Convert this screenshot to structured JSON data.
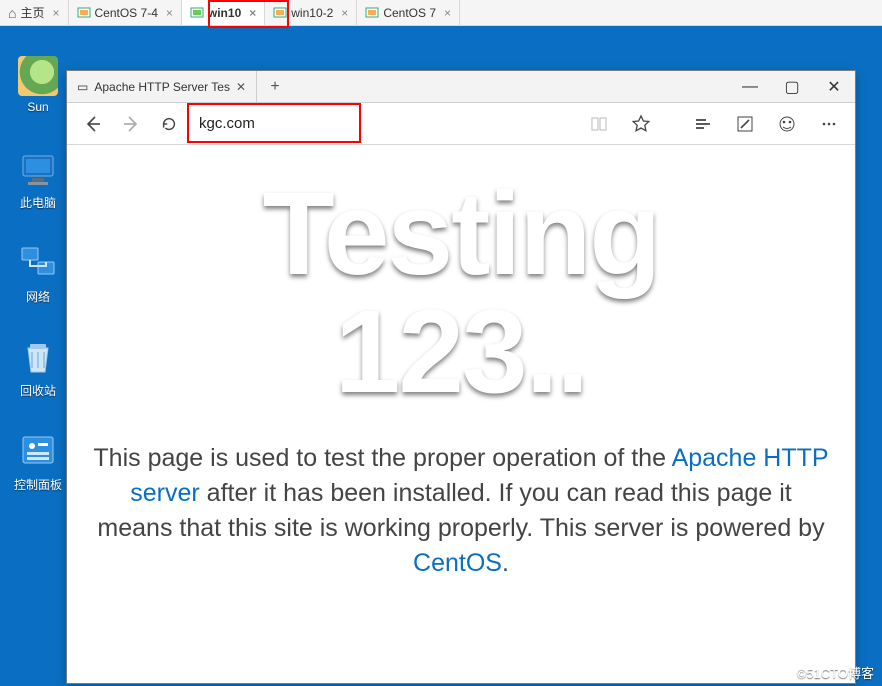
{
  "vm_tabs": [
    {
      "label": "主页",
      "type": "home"
    },
    {
      "label": "CentOS 7-4",
      "type": "vm"
    },
    {
      "label": "win10",
      "type": "vm",
      "active": true
    },
    {
      "label": "win10-2",
      "type": "vm"
    },
    {
      "label": "CentOS 7",
      "type": "vm"
    }
  ],
  "desktop_icons": {
    "sun": "Sun",
    "pc": "此电脑",
    "net": "网络",
    "bin": "回收站",
    "cpl": "控制面板"
  },
  "browser": {
    "tab_title": "Apache HTTP Server Tes",
    "url": "kgc.com",
    "controls": {
      "min": "—",
      "max": "▢",
      "close": "✕"
    }
  },
  "page": {
    "heading_l1": "Testing",
    "heading_l2": "123..",
    "p_before": "This page is used to test the proper operation of the ",
    "link1": "Apache HTTP server",
    "p_mid": " after it has been installed. If you can read this page it means that this site is working properly. This server is powered by ",
    "link2": "CentOS",
    "p_end": "."
  },
  "watermark": "©51CTO博客"
}
